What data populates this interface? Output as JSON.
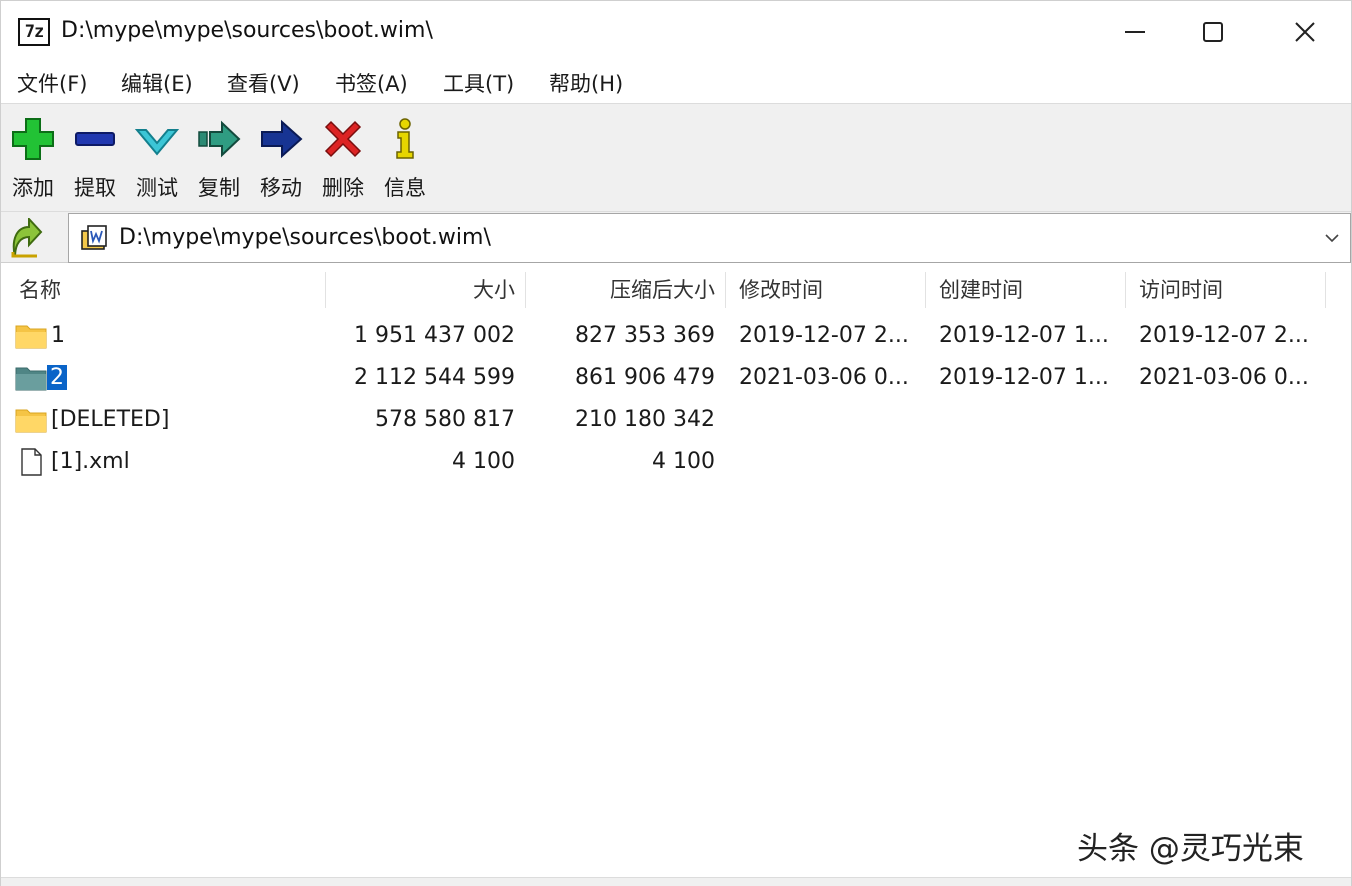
{
  "window": {
    "title": "D:\\mype\\mype\\sources\\boot.wim\\",
    "app_icon_text": "7z"
  },
  "menu": [
    {
      "label": "文件(F)"
    },
    {
      "label": "编辑(E)"
    },
    {
      "label": "查看(V)"
    },
    {
      "label": "书签(A)"
    },
    {
      "label": "工具(T)"
    },
    {
      "label": "帮助(H)"
    }
  ],
  "toolbar": [
    {
      "label": "添加",
      "icon": "add-plus-icon",
      "color": "#19b32a"
    },
    {
      "label": "提取",
      "icon": "extract-minus-icon",
      "color": "#1a2fa3"
    },
    {
      "label": "测试",
      "icon": "test-check-icon",
      "color": "#2bb6c9"
    },
    {
      "label": "复制",
      "icon": "copy-arrow-icon",
      "color": "#2b8a74"
    },
    {
      "label": "移动",
      "icon": "move-arrow-icon",
      "color": "#122a7a"
    },
    {
      "label": "删除",
      "icon": "delete-x-icon",
      "color": "#d42020"
    },
    {
      "label": "信息",
      "icon": "info-icon",
      "color": "#d8c800"
    }
  ],
  "address": {
    "path": "D:\\mype\\mype\\sources\\boot.wim\\"
  },
  "columns": [
    {
      "label": "名称"
    },
    {
      "label": "大小"
    },
    {
      "label": "压缩后大小"
    },
    {
      "label": "修改时间"
    },
    {
      "label": "创建时间"
    },
    {
      "label": "访问时间"
    }
  ],
  "rows": [
    {
      "name": "1",
      "type": "folder",
      "size": "1 951 437 002",
      "packed": "827 353 369",
      "modified": "2019-12-07 2...",
      "created": "2019-12-07 1...",
      "accessed": "2019-12-07 2..."
    },
    {
      "name": "2",
      "type": "folder-selected",
      "size": "2 112 544 599",
      "packed": "861 906 479",
      "modified": "2021-03-06 0...",
      "created": "2019-12-07 1...",
      "accessed": "2021-03-06 0..."
    },
    {
      "name": "[DELETED]",
      "type": "folder",
      "size": "578 580 817",
      "packed": "210 180 342",
      "modified": "",
      "created": "",
      "accessed": ""
    },
    {
      "name": "[1].xml",
      "type": "file",
      "size": "4 100",
      "packed": "4 100",
      "modified": "",
      "created": "",
      "accessed": ""
    }
  ],
  "watermark": "头条 @灵巧光束",
  "colors": {
    "toolbar_bg": "#f0f0f0",
    "selection": "#0a64c8",
    "folder": "#f5c445",
    "folder_selected": "#5b8f8f"
  }
}
